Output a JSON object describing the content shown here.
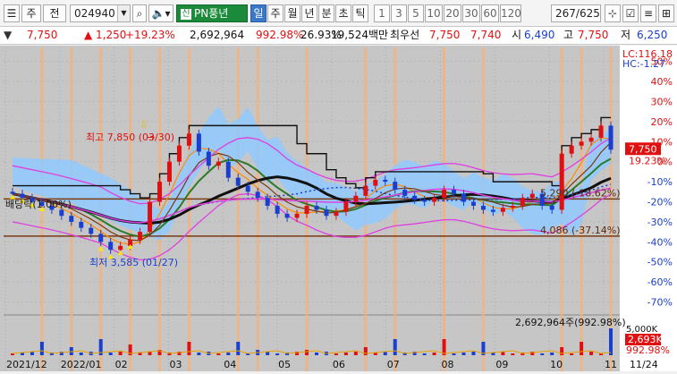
{
  "toolbar": {
    "market": "주",
    "prev_label": "전",
    "code": "024940",
    "company": "PN풍년",
    "periods": [
      "일",
      "주",
      "월",
      "년",
      "분",
      "초",
      "틱"
    ],
    "active_period": "일",
    "intervals": [
      "1",
      "3",
      "5",
      "10",
      "20",
      "30",
      "60",
      "120"
    ],
    "page_counter": "267/625"
  },
  "quote": {
    "price": "7,750",
    "change": "1,250",
    "change_pct": "+19.23%",
    "volume": "2,692,964",
    "vol_ratio": "992.98%",
    "turnover": "26.93%",
    "amount": "19,524백만",
    "best_ask_label": "최우선",
    "best_ask": "7,750",
    "best_bid": "7,740",
    "open_label": "시",
    "open": "6,490",
    "high_label": "고",
    "high": "7,750",
    "low_label": "저",
    "low": "6,250"
  },
  "chart_data": {
    "type": "candlestick",
    "right_axis": {
      "top_label_lc": "LC:116.18",
      "top_label_hc": "HC:-1.27",
      "ticks": [
        "50%",
        "40%",
        "30%",
        "20%",
        "10%",
        "0%",
        "-10%",
        "-20%",
        "-30%",
        "-40%",
        "-50%",
        "-60%",
        "-70%"
      ],
      "current_price": "7,750",
      "current_pct": "19.23%",
      "pct_range": [
        -76,
        57
      ]
    },
    "x_labels": [
      "2021/12",
      "2022/01",
      "02",
      "03",
      "04",
      "05",
      "06",
      "07",
      "08",
      "09",
      "10",
      "11"
    ],
    "last_date": "11/24",
    "annotations": {
      "high_text": "최고 7,850 (03/30)",
      "low_text": "최저 3,585 (01/27)",
      "dividend_text": "배당락(1.00%)",
      "support_1": "5,290 (-18.62%)",
      "support_2": "4,086 (-37.14%)"
    },
    "support_levels_pct": [
      -18.62,
      -37.14
    ],
    "volume_panel": {
      "label": "2,692,964주(992.98%)",
      "axis_top": "5,000K",
      "current": "2,693K",
      "current_pct": "992.98%"
    },
    "price_series_pct": [
      -16,
      -18,
      -20,
      -22,
      -24,
      -27,
      -30,
      -33,
      -36,
      -40,
      -44,
      -42,
      -39,
      -35,
      -20,
      -10,
      0,
      8,
      14,
      5,
      -2,
      0,
      -8,
      -12,
      -15,
      -18,
      -22,
      -26,
      -28,
      -26,
      -22,
      -24,
      -27,
      -25,
      -20,
      -17,
      -12,
      -9,
      -10,
      -14,
      -17,
      -19,
      -20,
      -18,
      -14,
      -16,
      -20,
      -22,
      -24,
      -25,
      -23,
      -22,
      -18,
      -16,
      -22,
      -24,
      4,
      8,
      10,
      12,
      18,
      6
    ],
    "colors": {
      "up": "#e01010",
      "down": "#1a3fd0",
      "accent": "#3b78c8"
    }
  }
}
